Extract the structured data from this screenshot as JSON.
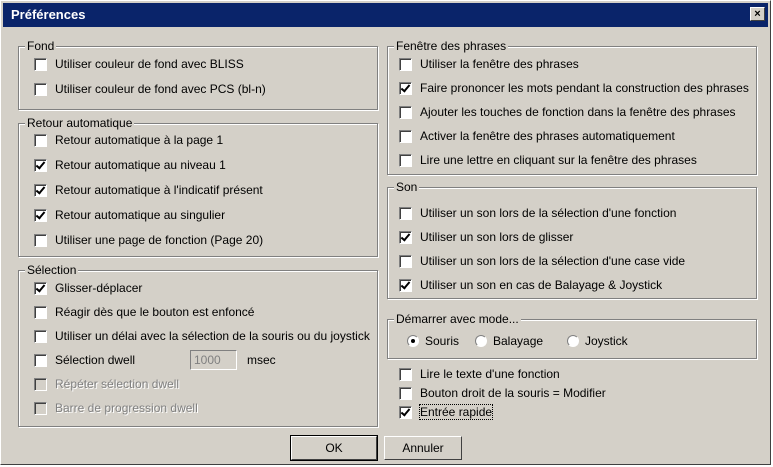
{
  "window": {
    "title": "Préférences",
    "close": "×"
  },
  "fond": {
    "title": "Fond",
    "items": [
      {
        "label": "Utiliser couleur de fond avec BLISS",
        "checked": false
      },
      {
        "label": "Utiliser couleur de fond avec PCS (bl-n)",
        "checked": false
      }
    ]
  },
  "retour": {
    "title": "Retour automatique",
    "items": [
      {
        "label": "Retour automatique à la page 1",
        "checked": false
      },
      {
        "label": "Retour automatique au niveau 1",
        "checked": true
      },
      {
        "label": "Retour automatique à l'indicatif présent",
        "checked": true
      },
      {
        "label": "Retour automatique au singulier",
        "checked": true
      },
      {
        "label": "Utiliser une page de fonction (Page 20)",
        "checked": false
      }
    ]
  },
  "selection": {
    "title": "Sélection",
    "items": [
      {
        "label": "Glisser-déplacer",
        "checked": true
      },
      {
        "label": "Réagir dès que le bouton est enfoncé",
        "checked": false
      },
      {
        "label": "Utiliser un délai avec la sélection de la souris ou du joystick",
        "checked": false
      },
      {
        "label": "Sélection dwell",
        "checked": false
      },
      {
        "label": "Répéter sélection dwell",
        "checked": false,
        "disabled": true
      },
      {
        "label": "Barre de progression dwell",
        "checked": false,
        "disabled": true
      }
    ],
    "dwell_value": "1000",
    "dwell_unit": "msec"
  },
  "fenetre": {
    "title": "Fenêtre des phrases",
    "items": [
      {
        "label": "Utiliser la fenêtre des phrases",
        "checked": false
      },
      {
        "label": "Faire prononcer les mots pendant la construction des phrases",
        "checked": true
      },
      {
        "label": "Ajouter les touches de fonction dans la fenêtre des phrases",
        "checked": false
      },
      {
        "label": "Activer la fenêtre des phrases automatiquement",
        "checked": false
      },
      {
        "label": "Lire une lettre en cliquant sur la fenêtre des phrases",
        "checked": false
      }
    ]
  },
  "son": {
    "title": "Son",
    "items": [
      {
        "label": "Utiliser un son lors de la sélection d'une fonction",
        "checked": false
      },
      {
        "label": "Utiliser un son lors de glisser",
        "checked": true
      },
      {
        "label": "Utiliser un son lors de la sélection d'une case vide",
        "checked": false
      },
      {
        "label": "Utiliser un son en cas de Balayage & Joystick",
        "checked": true
      }
    ]
  },
  "demarrer": {
    "title": "Démarrer avec mode...",
    "options": [
      {
        "label": "Souris",
        "selected": true
      },
      {
        "label": "Balayage",
        "selected": false
      },
      {
        "label": "Joystick",
        "selected": false
      }
    ]
  },
  "misc": {
    "items": [
      {
        "label": "Lire le texte d'une fonction",
        "checked": false
      },
      {
        "label": "Bouton droit de la souris = Modifier",
        "checked": false
      },
      {
        "label": "Entrée rapide",
        "checked": true
      }
    ]
  },
  "buttons": {
    "ok": "OK",
    "cancel": "Annuler"
  }
}
